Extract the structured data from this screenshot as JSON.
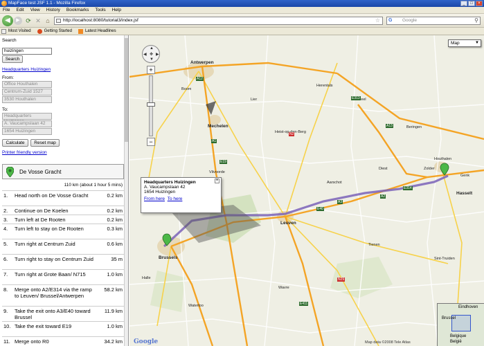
{
  "window": {
    "title": "MapFace test JSF 1.1 - Mozilla Firefox",
    "controls": [
      "_",
      "□",
      "×"
    ]
  },
  "menu": [
    "File",
    "Edit",
    "View",
    "History",
    "Bookmarks",
    "Tools",
    "Help"
  ],
  "navbar": {
    "url": "http://localhost:8080/tutorial3/index.jsf",
    "search_placeholder": "Google"
  },
  "bookmarks": [
    {
      "label": "Most Visited",
      "icon": "page-icon"
    },
    {
      "label": "Getting Started",
      "icon": "firefox-icon"
    },
    {
      "label": "Latest Headlines",
      "icon": "rss-icon"
    }
  ],
  "sidebar": {
    "search_label": "Search",
    "search_value": "huizingen",
    "search_button": "Search",
    "result_link": "Headquarters Huizingen",
    "from_label": "From:",
    "from_lines": [
      "Office Houthalen",
      "Centrum-Zuid 1527",
      "3530 Houthalen"
    ],
    "to_label": "To:",
    "to_lines": [
      "Headquarters Huizingen",
      "A. Vaucampslaan 42",
      "1654 Huizingen"
    ],
    "calculate_button": "Calculate",
    "reset_button": "Reset map",
    "printer_link": "Printer friendly version",
    "destination": "De Vosse Gracht",
    "summary": "110 km (about 1 hour 5 mins)",
    "steps": [
      {
        "num": "1.",
        "text": "Head north on De Vosse Gracht",
        "dist": "0.2 km"
      },
      {
        "num": "2.",
        "text": "Continue on De Koelen",
        "dist": "0.2 km"
      },
      {
        "num": "3.",
        "text": "Turn left at De Rooten",
        "dist": "0.2 km"
      },
      {
        "num": "4.",
        "text": "Turn left to stay on De Rooten",
        "dist": "0.3 km"
      },
      {
        "num": "5.",
        "text": "Turn right at Centrum Zuid",
        "dist": "0.6 km"
      },
      {
        "num": "6.",
        "text": "Turn right to stay on Centrum Zuid",
        "dist": "35 m"
      },
      {
        "num": "7.",
        "text": "Turn right at Grote Baan/ N715",
        "dist": "1.0 km"
      },
      {
        "num": "8.",
        "text": "Merge onto A2/E314 via the ramp to Leuven/ Brussel/Antwerpen",
        "dist": "58.2 km"
      },
      {
        "num": "9.",
        "text": "Take the exit onto A3/E40 toward Brussel",
        "dist": "11.9 km"
      },
      {
        "num": "10.",
        "text": "Take the exit toward E19",
        "dist": "1.0 km"
      },
      {
        "num": "11.",
        "text": "Merge onto R0",
        "dist": "34.2 km"
      }
    ]
  },
  "map": {
    "type_label": "Map",
    "pan": {
      "up": "▲",
      "left": "◀",
      "right": "▶",
      "down": "▼",
      "center": "✥"
    },
    "zoom": {
      "in": "+",
      "out": "−"
    },
    "info": {
      "title": "Headquarters Huizingen",
      "line1": "A. Vaucampslaan 42",
      "line2": "1654 Huizingen",
      "from_link": "From here",
      "to_link": "To here"
    },
    "copyright": "Map data ©2008 Tele Atlas",
    "logo": "Google",
    "places": [
      {
        "name": "Antwerpen",
        "big": true
      },
      {
        "name": "Mechelen",
        "big": true
      },
      {
        "name": "Leuven",
        "big": true
      },
      {
        "name": "Brussels",
        "big": true
      },
      {
        "name": "Hasselt",
        "big": true
      },
      {
        "name": "Houthalen",
        "big": false
      },
      {
        "name": "Zolder",
        "big": false
      },
      {
        "name": "Diest",
        "big": false
      },
      {
        "name": "Aarschot",
        "big": false
      },
      {
        "name": "Heist-op-den-Berg",
        "big": false
      },
      {
        "name": "Tienen",
        "big": false
      },
      {
        "name": "Wavre",
        "big": false
      },
      {
        "name": "Lier",
        "big": false
      },
      {
        "name": "Geel",
        "big": false
      },
      {
        "name": "Herentals",
        "big": false
      },
      {
        "name": "Vilvoorde",
        "big": false
      },
      {
        "name": "Halle",
        "big": false
      },
      {
        "name": "Waterloo",
        "big": false
      },
      {
        "name": "Sint-Truiden",
        "big": false
      },
      {
        "name": "Genk",
        "big": false
      },
      {
        "name": "Boom",
        "big": false
      },
      {
        "name": "Beringen",
        "big": false
      }
    ],
    "shields": [
      "A12",
      "A1",
      "E19",
      "A13",
      "E313",
      "A2",
      "E314",
      "A3",
      "E40",
      "E411",
      "N2",
      "N29"
    ],
    "overview_labels": [
      "Eindhoven",
      "Brussel",
      "Belgique",
      "België"
    ]
  }
}
